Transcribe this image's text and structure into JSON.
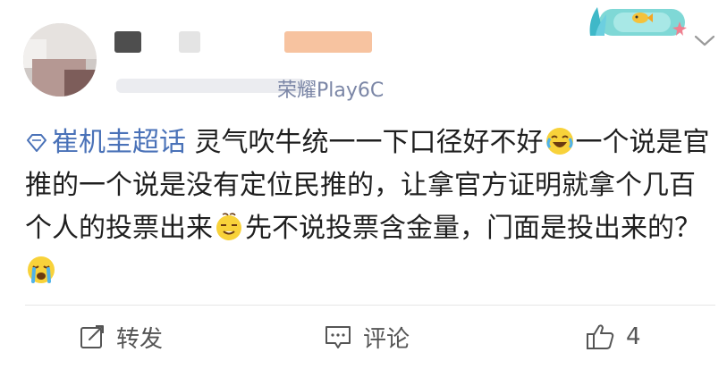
{
  "post": {
    "meta_visible_text": "荣耀Play6C",
    "topic": "崔机圭超话",
    "body_segments": [
      " 灵气吹牛统一一下口径好不好",
      "一个说是官推的一个说是没有定位民推的，让拿官方证明就拿个几百个人的投票出来",
      "先不说投票含金量，门面是投出来的？"
    ],
    "emojis": [
      "laugh-cry-emoji",
      "awkward-sweat-emoji",
      "crying-emoji"
    ]
  },
  "actions": {
    "repost_label": "转发",
    "comment_label": "评论",
    "like_count": "4"
  },
  "colors": {
    "topic": "#4a72b8",
    "meta": "#7b86a6",
    "text": "#1f1f1f",
    "action_text": "#555555",
    "divider": "#e6e6e6"
  },
  "icons": [
    "diamond-topic-icon",
    "repost-icon",
    "comment-icon",
    "thumbs-up-icon",
    "chevron-down-icon"
  ]
}
